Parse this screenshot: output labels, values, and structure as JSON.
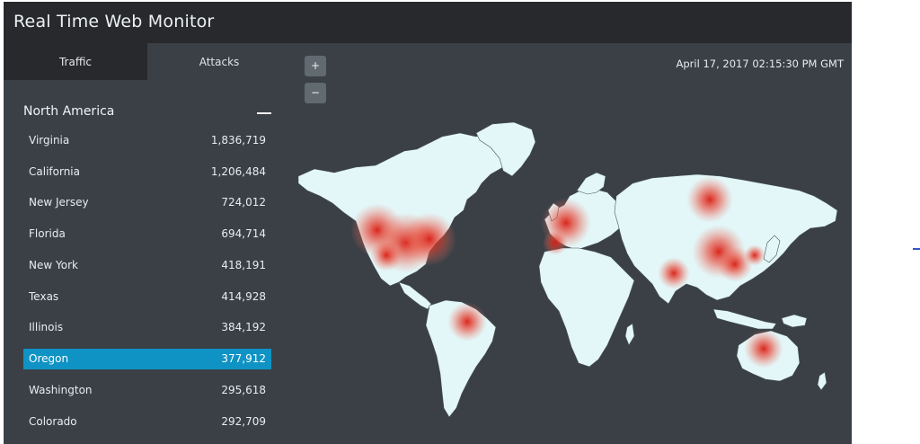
{
  "app": {
    "title": "Real Time Web Monitor"
  },
  "tabs": [
    {
      "label": "Traffic",
      "active": true
    },
    {
      "label": "Attacks",
      "active": false
    }
  ],
  "region": {
    "name": "North America"
  },
  "list": [
    {
      "name": "Virginia",
      "value": "1,836,719"
    },
    {
      "name": "California",
      "value": "1,206,484"
    },
    {
      "name": "New Jersey",
      "value": "724,012"
    },
    {
      "name": "Florida",
      "value": "694,714"
    },
    {
      "name": "New York",
      "value": "418,191"
    },
    {
      "name": "Texas",
      "value": "414,928"
    },
    {
      "name": "Illinois",
      "value": "384,192"
    },
    {
      "name": "Oregon",
      "value": "377,912",
      "selected": true
    },
    {
      "name": "Washington",
      "value": "295,618"
    },
    {
      "name": "Colorado",
      "value": "292,709"
    }
  ],
  "map": {
    "zoom_in": "+",
    "zoom_out": "−",
    "timestamp": "April 17, 2017 02:15:30 PM GMT",
    "land_color": "#e3f7f9",
    "ocean_color": "#3a4046",
    "heat_color": "#e0241a"
  },
  "colors": {
    "header": "#27292c",
    "panel": "#3a4046",
    "selected": "#0f93c4"
  }
}
